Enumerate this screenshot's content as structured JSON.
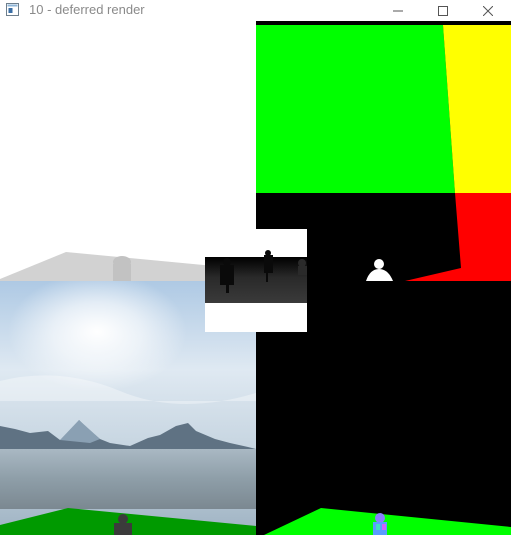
{
  "window": {
    "title": "10 - deferred render",
    "icon": "app-window-icon",
    "controls": [
      "minimize-icon",
      "maximize-icon",
      "close-icon"
    ]
  },
  "colors": {
    "green": "#00ff00",
    "yellow": "#ffff00",
    "red": "#ff0000",
    "black": "#000000",
    "white": "#ffffff"
  }
}
